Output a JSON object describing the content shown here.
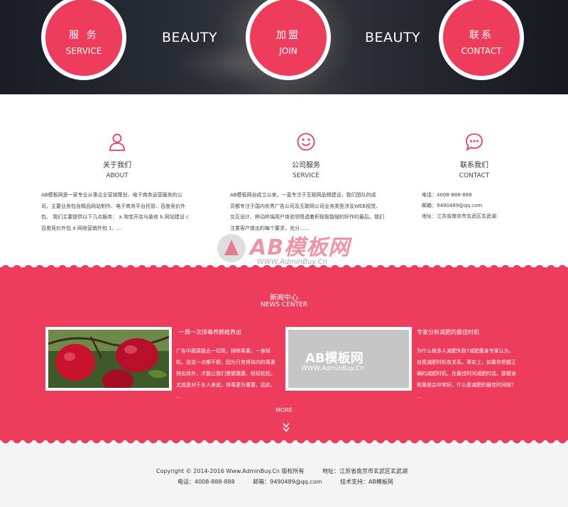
{
  "hero": {
    "circles": [
      {
        "zh": "服 务",
        "en": "SERVICE"
      },
      {
        "zh": "加盟",
        "en": "JOIN"
      },
      {
        "zh": "联系",
        "en": "CONTACT"
      }
    ],
    "word1": "BEAUTY",
    "word2": "BEAUTY"
  },
  "info": {
    "about": {
      "icon": "person-icon",
      "title": "关于我们",
      "sub": "ABOUT",
      "lines": [
        "AB模板网是一家专业从事企业营销策划、电子商务运营服务的公",
        "司，主要业务包含精品网站制作、电子商务平台托管、百度竞价外",
        "包、 我们主要提供以下几点服务： a 淘宝开店与装修 b 网站建设 c",
        "百度竞价外包 d 网络营销外包 1、..."
      ]
    },
    "service": {
      "icon": "smiley-icon",
      "title": "公司服务",
      "sub": "SERVICE",
      "lines": [
        "AB模板网自成立以来，一直专注于互联网品牌建设，我们团队的成",
        "员都专注于国内优秀广告公司及互联网公司业务类型涉及WEB视觉、",
        "交互设计、移动终端用户体验领悟透着积极智能赋的好作的最后。我们",
        "注重客户提出的每个要求，充分......"
      ]
    },
    "contact": {
      "icon": "chat-bubble-icon",
      "title": "联系我们",
      "sub": "CONTACT",
      "lines": [
        "电话：4008-888-888",
        "邮箱：9490489@qq.com",
        "地址：江苏省南京市玄武区玄武湖"
      ]
    }
  },
  "watermark": {
    "logo": "AB模板网",
    "url": "WWW.AdminBuy.Cn"
  },
  "news": {
    "title": "新闻中心",
    "sub": "NEWS CENTER",
    "items": [
      {
        "headline": "一周一次排毒养颜植养出",
        "lines": [
          "广告中蔬菜能去一切斑，排除毒素，一身轻",
          "松。说说一点都不假，因为只有将体内的毒素",
          "排出体外，才能让我们健健康康、轻轻松松。",
          "尤其是对于女人来说，排毒更为重要，因此，",
          "..."
        ]
      },
      {
        "headline": "专家分析减肥的最佳时机",
        "lines": [
          "为什么很多人减肥失败?减肥瘦身专家认为，",
          "自愿减肥时机有关系。事实上，如果你把握正",
          "确的减肥时机，在最佳时间减肥的话，那瘦身",
          "效果就会非常好。什么是减肥的最佳时间呢?",
          "..."
        ]
      }
    ],
    "placeholder_logo": "AB模板网",
    "placeholder_url": "WWW.AdminBuy.Cn",
    "more": "MORE"
  },
  "footer": {
    "line1": "Copyright © 2014-2016 Www.AdminBuy.Cn 版权所有          地址：江苏省南京市玄武区玄武湖",
    "line2": "电话：4008-888-888          邮箱：9490489@qq.com          技术支持：AB模板网"
  },
  "colors": {
    "accent": "#ee3c5c",
    "hero_bg": "#252830",
    "footer_bg": "#f4f4f4"
  }
}
